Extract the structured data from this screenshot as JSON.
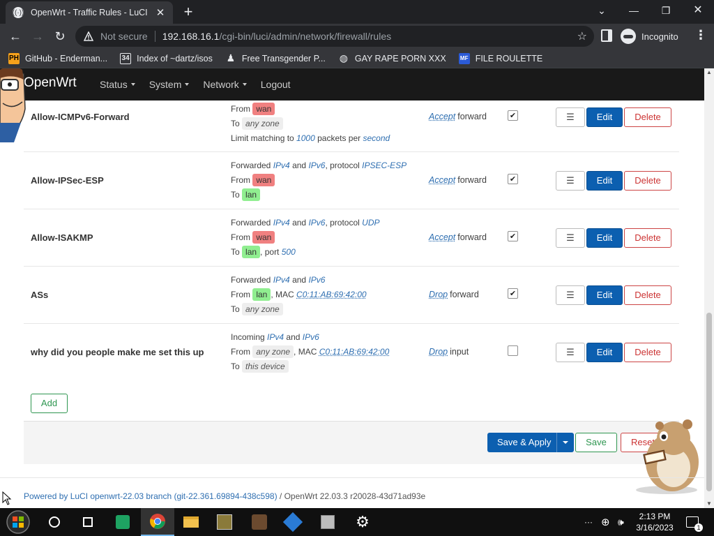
{
  "browser": {
    "tab_title": "OpenWrt - Traffic Rules - LuCI",
    "not_secure": "Not secure",
    "url_host": "192.168.16.1",
    "url_path": "/cgi-bin/luci/admin/network/firewall/rules",
    "profile_label": "Incognito",
    "bookmarks": [
      {
        "label": "GitHub - Enderman...",
        "icon": "ph-icon"
      },
      {
        "label": "Index of ~dartz/isos",
        "icon": "isos-icon"
      },
      {
        "label": "Free Transgender P...",
        "icon": "pawn-icon"
      },
      {
        "label": "GAY RAPE PORN XXX",
        "icon": "globe-icon"
      },
      {
        "label": "FILE ROULETTE",
        "icon": "mf-icon"
      }
    ]
  },
  "luci": {
    "brand": "OpenWrt",
    "menu": [
      "Status",
      "System",
      "Network",
      "Logout"
    ]
  },
  "rules": [
    {
      "name": "Allow-ICMPv6-Forward",
      "line1_prefix": "From",
      "line1_zone": "wan",
      "line2_prefix": "To",
      "line2_zone": "any zone",
      "line3_a": "Limit matching to",
      "line3_num": "1000",
      "line3_b": "packets per",
      "line3_unit": "second",
      "action": "Accept",
      "action_target": "forward",
      "enabled": true
    },
    {
      "name": "Allow-IPSec-ESP",
      "line1_a": "Forwarded",
      "line1_ipv4": "IPv4",
      "line1_and": "and",
      "line1_ipv6": "IPv6",
      "line1_proto_label": ", protocol",
      "line1_proto": "IPSEC-ESP",
      "line2_prefix": "From",
      "line2_zone": "wan",
      "line3_prefix": "To",
      "line3_zone": "lan",
      "action": "Accept",
      "action_target": "forward",
      "enabled": true
    },
    {
      "name": "Allow-ISAKMP",
      "line1_a": "Forwarded",
      "line1_ipv4": "IPv4",
      "line1_and": "and",
      "line1_ipv6": "IPv6",
      "line1_proto_label": ", protocol",
      "line1_proto": "UDP",
      "line2_prefix": "From",
      "line2_zone": "wan",
      "line3_prefix": "To",
      "line3_zone": "lan",
      "line3_port_label": ", port",
      "line3_port": "500",
      "action": "Accept",
      "action_target": "forward",
      "enabled": true
    },
    {
      "name": "ASs",
      "line1_a": "Forwarded",
      "line1_ipv4": "IPv4",
      "line1_and": "and",
      "line1_ipv6": "IPv6",
      "line2_prefix": "From",
      "line2_zone": "lan",
      "line2_mac_label": ", MAC",
      "line2_mac": "C0:11:AB:69:42:00",
      "line3_prefix": "To",
      "line3_zone": "any zone",
      "action": "Drop",
      "action_target": "forward",
      "enabled": true
    },
    {
      "name": "why did you people make me set this up",
      "line1_a": "Incoming",
      "line1_ipv4": "IPv4",
      "line1_and": "and",
      "line1_ipv6": "IPv6",
      "line2_prefix": "From",
      "line2_zone": "any zone",
      "line2_mac_label": ", MAC",
      "line2_mac": "C0:11:AB:69:42:00",
      "line3_prefix": "To",
      "line3_zone": "this device",
      "action": "Drop",
      "action_target": "input",
      "enabled": false
    }
  ],
  "buttons": {
    "drag": "☰",
    "edit": "Edit",
    "delete": "Delete",
    "add": "Add",
    "save_apply": "Save & Apply",
    "save": "Save",
    "reset": "Reset"
  },
  "footer": {
    "luci_link": "Powered by LuCI openwrt-22.03 branch (git-22.361.69894-438c598)",
    "version": "/ OpenWrt 22.03.3 r20028-43d71ad93e"
  },
  "taskbar": {
    "time": "2:13 PM",
    "date": "3/16/2023",
    "notifications": "1"
  },
  "colors": {
    "zone_wan": "#f08080",
    "zone_lan": "#90ee90",
    "edit_button": "#0c5fb0",
    "delete_button": "#cc3333",
    "add_button": "#2e9650"
  }
}
